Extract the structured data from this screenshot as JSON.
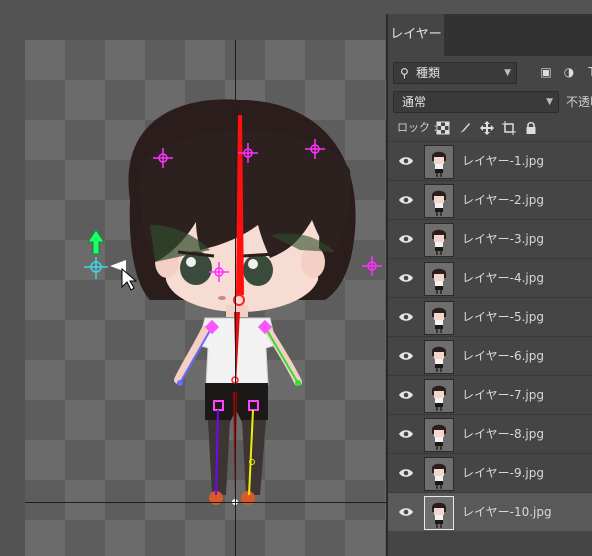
{
  "panel": {
    "tab_label": "レイヤー",
    "filter": {
      "kind_label": "種類",
      "icons": [
        "image-filter-icon",
        "adjustment-filter-icon",
        "type-filter-icon"
      ]
    },
    "blend_mode": "通常",
    "opacity_label": "不透明度",
    "lock_label": "ロック :",
    "layers": [
      {
        "name": "レイヤー-1.jpg",
        "visible": true,
        "selected": false
      },
      {
        "name": "レイヤー-2.jpg",
        "visible": true,
        "selected": false
      },
      {
        "name": "レイヤー-3.jpg",
        "visible": true,
        "selected": false
      },
      {
        "name": "レイヤー-4.jpg",
        "visible": true,
        "selected": false
      },
      {
        "name": "レイヤー-5.jpg",
        "visible": true,
        "selected": false
      },
      {
        "name": "レイヤー-6.jpg",
        "visible": true,
        "selected": false
      },
      {
        "name": "レイヤー-7.jpg",
        "visible": true,
        "selected": false
      },
      {
        "name": "レイヤー-8.jpg",
        "visible": true,
        "selected": false
      },
      {
        "name": "レイヤー-9.jpg",
        "visible": true,
        "selected": false
      },
      {
        "name": "レイヤー-10.jpg",
        "visible": true,
        "selected": true
      }
    ]
  },
  "canvas": {
    "rig_colors": {
      "spine": "#ff0000",
      "pins": "#ff00ff",
      "left_arm": "#7777ff",
      "right_arm": "#33dd33",
      "left_leg": "#7700ff",
      "right_leg": "#eeee00",
      "gizmo": "#22ff66"
    }
  }
}
